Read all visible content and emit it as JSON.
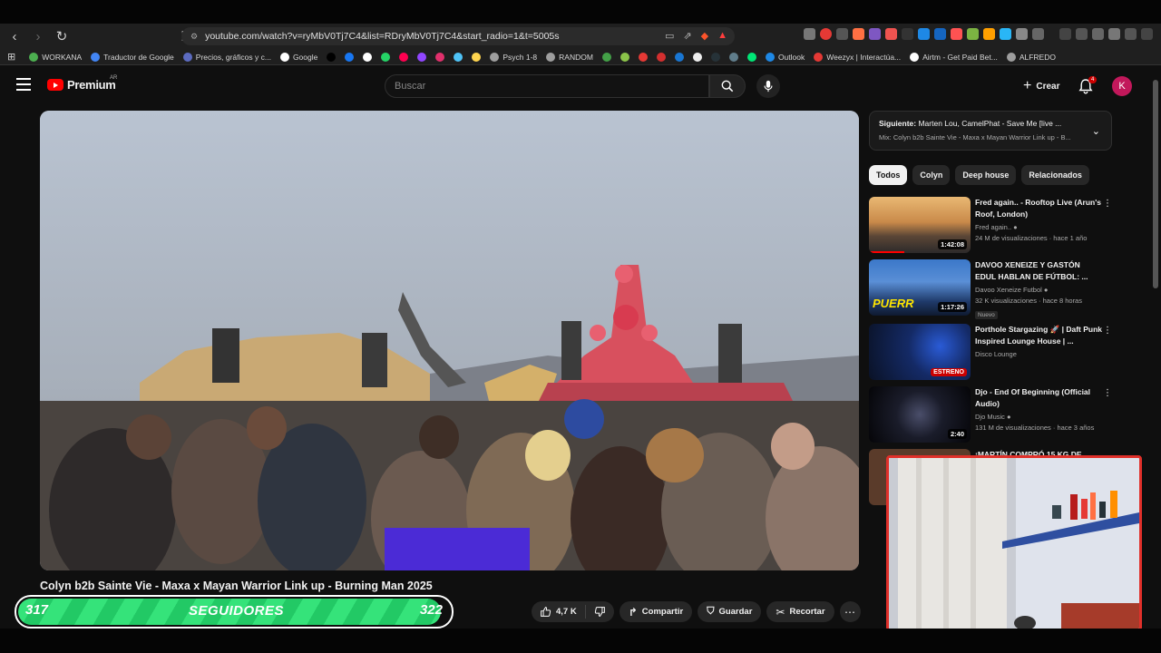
{
  "browser": {
    "url": "youtube.com/watch?v=ryMbV0Tj7C4&list=RDryMbV0Tj7C4&start_radio=1&t=5005s",
    "bookmarks": [
      {
        "label": "WORKANA",
        "color": "#4caf50"
      },
      {
        "label": "Traductor de Google",
        "color": "#4285f4"
      },
      {
        "label": "Precios, gráficos y c...",
        "color": "#5c6bc0"
      },
      {
        "label": "Google",
        "color": "#ffffff"
      },
      {
        "label": "",
        "color": "#000000"
      },
      {
        "label": "",
        "color": "#1877f2"
      },
      {
        "label": "",
        "color": "#ffffff"
      },
      {
        "label": "",
        "color": "#25d366"
      },
      {
        "label": "",
        "color": "#ff0050"
      },
      {
        "label": "",
        "color": "#9146ff"
      },
      {
        "label": "",
        "color": "#e1306c"
      },
      {
        "label": "",
        "color": "#4fc3f7"
      },
      {
        "label": "",
        "color": "#ffd54f"
      },
      {
        "label": "Psych 1-8",
        "color": "#9e9e9e"
      },
      {
        "label": "RANDOM",
        "color": "#9e9e9e"
      },
      {
        "label": "",
        "color": "#43a047"
      },
      {
        "label": "",
        "color": "#8bc34a"
      },
      {
        "label": "",
        "color": "#e53935"
      },
      {
        "label": "",
        "color": "#d32f2f"
      },
      {
        "label": "",
        "color": "#1976d2"
      },
      {
        "label": "",
        "color": "#eeeeee"
      },
      {
        "label": "",
        "color": "#263238"
      },
      {
        "label": "",
        "color": "#607d8b"
      },
      {
        "label": "",
        "color": "#00e676"
      },
      {
        "label": "Outlook",
        "color": "#1e88e5"
      },
      {
        "label": "Weezyx | Interactúa...",
        "color": "#e53935"
      },
      {
        "label": "Airtm - Get Paid Bet...",
        "color": "#ffffff"
      },
      {
        "label": "ALFREDO",
        "color": "#9e9e9e"
      }
    ]
  },
  "header": {
    "logo_text": "Premium",
    "country_code": "AR",
    "search_placeholder": "Buscar",
    "create_label": "Crear",
    "notification_count": "4",
    "avatar_letter": "K"
  },
  "video": {
    "title": "Colyn b2b Sainte Vie - Maxa x Mayan Warrior Link up - Burning Man 2025",
    "likes": "4,7 K",
    "share_label": "Compartir",
    "save_label": "Guardar",
    "clip_label": "Recortar"
  },
  "overlay": {
    "current": "317",
    "label": "SEGUIDORES",
    "goal": "322",
    "progress": 0.98
  },
  "sidebar": {
    "next_label": "Siguiente:",
    "next_title": "Marten Lou, CamelPhat - Save Me [live ...",
    "mix_line": "Mix: Colyn b2b Sainte Vie - Maxa x Mayan Warrior Link up - B...",
    "chips": [
      "Todos",
      "Colyn",
      "Deep house",
      "Relacionados"
    ],
    "recommendations": [
      {
        "title": "Fred again.. - Rooftop Live (Arun's Roof, London)",
        "channel": "Fred again..",
        "meta": "24 M de visualizaciones · hace 1 año",
        "duration": "1:42:08",
        "badge": "",
        "progress": 0.35
      },
      {
        "title": "DAVOO XENEIZE Y GASTÓN EDUL HABLAN DE FÚTBOL: ...",
        "channel": "Davoo Xeneize Futbol",
        "meta": "32 K visualizaciones · hace 8 horas",
        "duration": "1:17:26",
        "badge": "Nuevo",
        "progress": 0
      },
      {
        "title": "Porthole Stargazing 🚀 | Daft Punk Inspired Lounge House | ...",
        "channel": "Disco Lounge",
        "meta": "",
        "duration": "ESTRENO",
        "badge": "",
        "progress": 0
      },
      {
        "title": "Djo - End Of Beginning (Official Audio)",
        "channel": "Djo Music",
        "meta": "131 M de visualizaciones · hace 3 años",
        "duration": "2:40",
        "badge": "",
        "progress": 0
      },
      {
        "title": "¡MARTÍN COMPRÓ 15 KG DE ...",
        "channel": "",
        "meta": "",
        "duration": "",
        "badge": "",
        "progress": 0
      }
    ]
  },
  "colors": {
    "accent": "#ff0000",
    "overlay_green": "#35e37a",
    "webcam_border": "#e0302a"
  }
}
